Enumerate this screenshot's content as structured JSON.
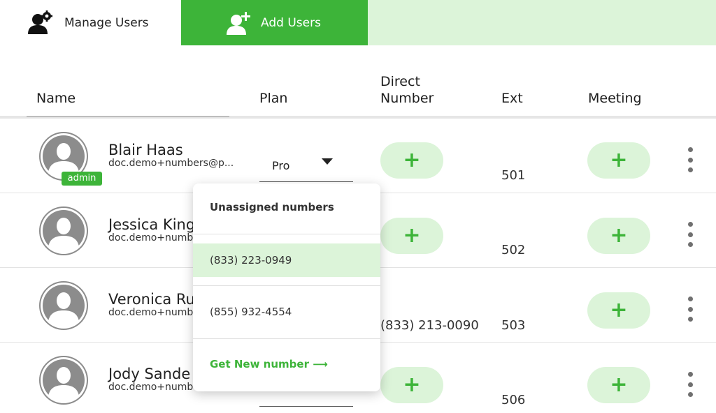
{
  "tabs": {
    "manage_label": "Manage Users",
    "add_label": "Add Users"
  },
  "columns": {
    "name": "Name",
    "plan": "Plan",
    "direct_line1": "Direct",
    "direct_line2": "Number",
    "ext": "Ext",
    "meeting": "Meeting"
  },
  "users": [
    {
      "name": "Blair Haas",
      "email": "doc.demo+numbers@p...",
      "badge": "admin",
      "plan": "Pro",
      "ext": "501",
      "direct_number": ""
    },
    {
      "name": "Jessica King",
      "email": "doc.demo+numb",
      "badge": "",
      "plan": "",
      "ext": "502",
      "direct_number": ""
    },
    {
      "name": "Veronica Ru",
      "email": "doc.demo+numb",
      "badge": "",
      "plan": "",
      "ext": "503",
      "direct_number": "(833) 213-0090"
    },
    {
      "name": "Jody Sande",
      "email": "doc.demo+numb",
      "badge": "",
      "plan": "",
      "ext": "506",
      "direct_number": ""
    }
  ],
  "dropdown": {
    "header": "Unassigned numbers",
    "options": [
      "(833) 223-0949",
      "(855) 932-4554"
    ],
    "selected_index": 0,
    "footer": "Get New number ⟶"
  },
  "plus_symbol": "+",
  "colors": {
    "accent": "#3db439",
    "accent_light": "#dcf4d9"
  }
}
